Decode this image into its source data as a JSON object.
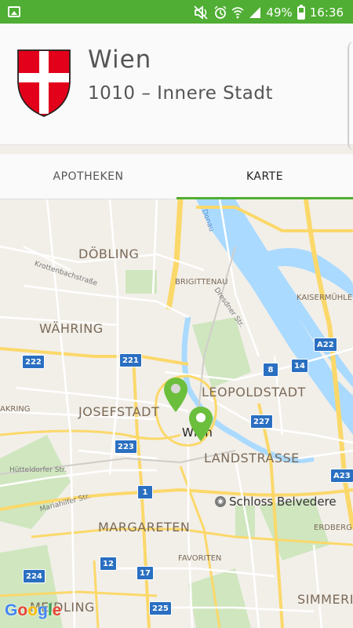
{
  "status_bar": {
    "battery": "49%",
    "time": "16:36",
    "icons": [
      "image-icon",
      "mute-icon",
      "alarm-icon",
      "wifi-icon",
      "signal-icon",
      "battery-icon"
    ]
  },
  "header": {
    "city": "Wien",
    "district": "1010 – Innere Stadt",
    "crest_colors": {
      "red": "#e2001a",
      "white": "#ffffff"
    }
  },
  "tabs": [
    {
      "label": "APOTHEKEN",
      "active": false
    },
    {
      "label": "KARTE",
      "active": true
    }
  ],
  "map": {
    "labels": {
      "doebling": "DÖBLING",
      "waehring": "WÄHRING",
      "josefstadt": "JOSEFSTADT",
      "leopoldstadt": "LEOPOLDSTADT",
      "landstrasse": "LANDSTRASSE",
      "margareten": "MARGARETEN",
      "brigittenau": "BRIGITTENAU",
      "kaisermuehlen": "KAISERMÜHLEN",
      "wien": "Wien",
      "favoriten": "FAVORITEN",
      "erdberg": "ERDBERG",
      "simmering": "SIMMERI",
      "meidling": "MEIDLING",
      "akring": "AKRING",
      "krottenbach": "Krottenbachstraße",
      "dresdner": "Dresdner Str.",
      "huetteldorfer": "Hütteldorfer Str.",
      "mariahilfer": "Mariahilfer Str.",
      "donau": "Donau"
    },
    "shields": {
      "s222": "222",
      "s221": "221",
      "s8": "8",
      "s14": "14",
      "sA22": "A22",
      "s227": "227",
      "s223": "223",
      "sA23": "A23",
      "s1": "1",
      "s12": "12",
      "s17": "17",
      "s224": "224",
      "s225": "225"
    },
    "poi": "Schloss Belvedere",
    "google_logo": "Google",
    "colors": {
      "water": "#aadaff",
      "park": "#c8e5b4",
      "road": "#ffffff",
      "highway": "#fbd86a",
      "pin": "#6cbf3d"
    }
  }
}
